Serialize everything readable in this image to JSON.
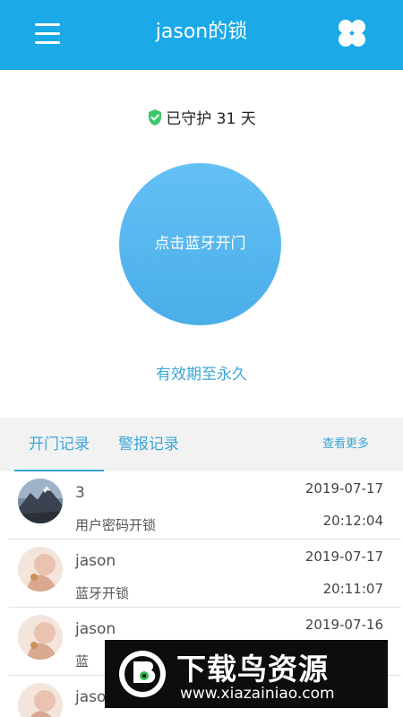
{
  "header": {
    "title": "jason的锁",
    "menu_icon": "menu-icon",
    "grid_icon": "grid-icon"
  },
  "status": {
    "guard_text": "已守护 31 天",
    "guard_icon": "shield-check-icon",
    "guard_icon_color": "#3cc96a"
  },
  "unlock": {
    "button_label": "点击蓝牙开门",
    "validity_text": "有效期至永久"
  },
  "tabs": {
    "items": [
      {
        "label": "开门记录",
        "active": true
      },
      {
        "label": "警报记录",
        "active": false
      }
    ],
    "view_more": "查看更多"
  },
  "records": [
    {
      "name": "3",
      "type": "用户密码开锁",
      "date": "2019-07-17",
      "time": "20:12:04",
      "avatar": "mountain-avatar"
    },
    {
      "name": "jason",
      "type": "蓝牙开锁",
      "date": "2019-07-17",
      "time": "20:11:07",
      "avatar": "person-avatar"
    },
    {
      "name": "jason",
      "type": "蓝",
      "date": "2019-07-16",
      "time": "",
      "avatar": "person-avatar"
    },
    {
      "name": "jaso",
      "type": "",
      "date": "",
      "time": "",
      "avatar": "person-avatar"
    }
  ],
  "watermark": {
    "title": "下载鸟资源",
    "url": "www.xiazainiao.com"
  },
  "colors": {
    "primary": "#1ba9e8",
    "accent": "#3ba6d8",
    "circle": "#5ab8f0"
  }
}
